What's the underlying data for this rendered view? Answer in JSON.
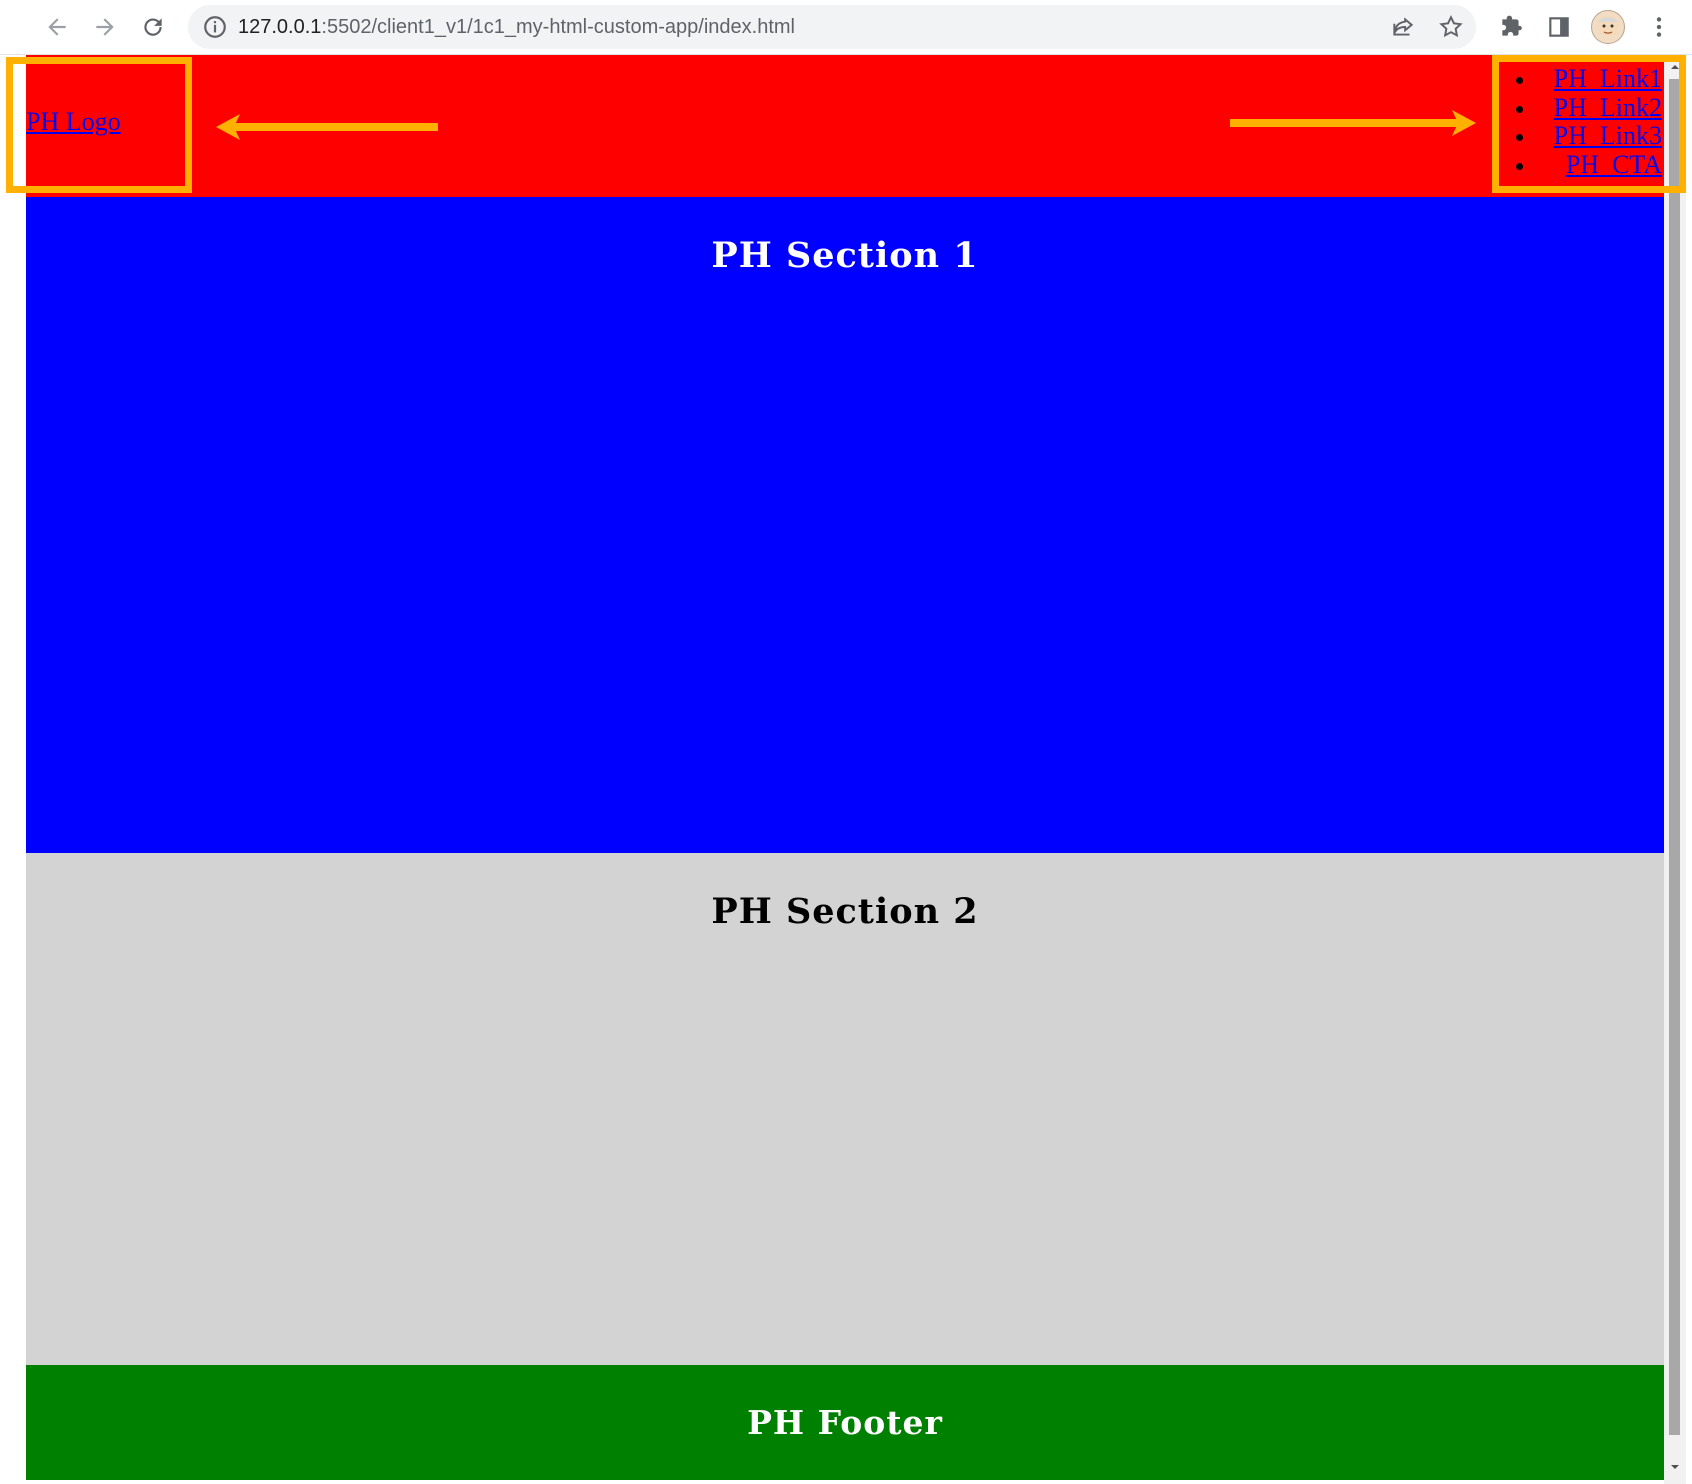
{
  "browser": {
    "url_host": "127.0.0.1",
    "url_path": ":5502/client1_v1/1c1_my-html-custom-app/index.html",
    "icons": [
      "back-icon",
      "forward-icon",
      "reload-icon",
      "site-info-icon",
      "share-icon",
      "bookmark-star-icon",
      "extensions-icon",
      "side-panel-icon",
      "profile-avatar",
      "more-menu-icon"
    ]
  },
  "page": {
    "header": {
      "logo": "PH Logo",
      "nav": [
        "PH_Link1",
        "PH_Link2",
        "PH_Link3",
        "PH_CTA"
      ]
    },
    "section1": {
      "title": "PH Section 1",
      "background": "#0000ff"
    },
    "section2": {
      "title": "PH Section 2",
      "background": "#d3d3d3"
    },
    "footer": {
      "title": "PH Footer",
      "background": "#008000"
    },
    "header_background": "#ff0000"
  },
  "annotations": {
    "highlight_color": "#ffb000",
    "items": [
      "logo-highlight-box",
      "nav-highlight-box",
      "arrow-left",
      "arrow-right"
    ]
  }
}
